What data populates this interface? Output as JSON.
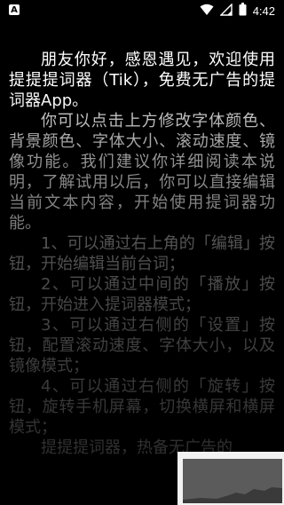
{
  "status_bar": {
    "notification_icon_letter": "A",
    "time": "4:42"
  },
  "teleprompter": {
    "paragraphs": [
      "朋友你好，感恩遇见，欢迎使用提提提词器（Tik），免费无广告的提词器App。",
      "你可以点击上方修改字体颜色、背景颜色、字体大小、滚动速度、镜像功能。我们建议你详细阅读本说明，了解试用以后，你可以直接编辑当前文本内容，开始使用提词器功能。",
      "1、可以通过右上角的「编辑」按钮，开始编辑当前台词；",
      "2、可以通过中间的「播放」按钮，开始进入提词器模式；",
      "3、可以通过右侧的「设置」按钮，配置滚动速度、字体大小，以及镜像模式；",
      "4、可以通过右侧的「旋转」按钮，旋转手机屏幕，切换横屏和横屏模式；",
      "提提提词器，热备无广告的"
    ]
  }
}
